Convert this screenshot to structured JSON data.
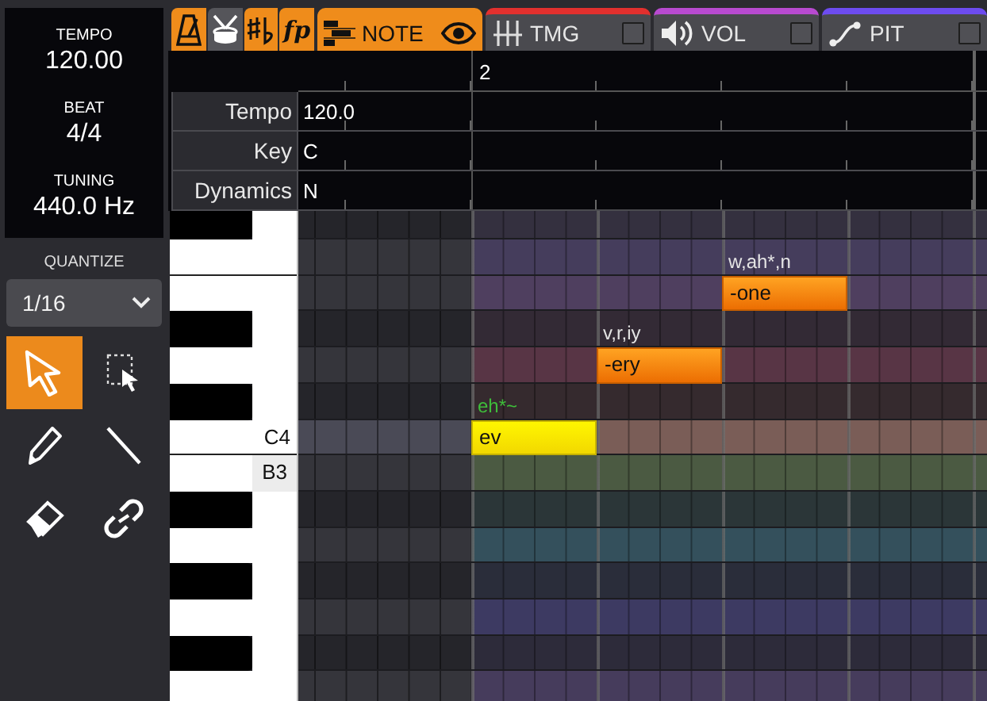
{
  "info": [
    {
      "label": "TEMPO",
      "value": "120.00"
    },
    {
      "label": "BEAT",
      "value": "4/4"
    },
    {
      "label": "TUNING",
      "value": "440.0 Hz"
    }
  ],
  "quantize": {
    "label": "QUANTIZE",
    "value": "1/16"
  },
  "tools": [
    {
      "kind": "select",
      "selected": true
    },
    {
      "kind": "marquee",
      "selected": false
    },
    {
      "kind": "pencil",
      "selected": false
    },
    {
      "kind": "line",
      "selected": false
    },
    {
      "kind": "eraser",
      "selected": false
    },
    {
      "kind": "link",
      "selected": false
    }
  ],
  "toggles": [
    {
      "kind": "metronome",
      "on": true
    },
    {
      "kind": "drum",
      "on": false
    },
    {
      "kind": "accidental",
      "on": true
    },
    {
      "kind": "dynamics",
      "label": "fp",
      "on": true
    }
  ],
  "tabs": [
    {
      "kind": "note",
      "label": "NOTE",
      "selected": true
    },
    {
      "kind": "timing",
      "label": "TMG",
      "color": "#e2302e",
      "selected": false,
      "checked": false
    },
    {
      "kind": "volume",
      "label": "VOL",
      "color": "#b84ad0",
      "selected": false,
      "checked": false
    },
    {
      "kind": "pitch",
      "label": "PIT",
      "color": "#6d4cf0",
      "selected": false,
      "checked": false
    }
  ],
  "ruler": {
    "bar": "2"
  },
  "expressions": [
    {
      "name": "Tempo",
      "value": "120.0"
    },
    {
      "name": "Key",
      "value": "C"
    },
    {
      "name": "Dynamics",
      "value": "N"
    }
  ],
  "rows": [
    {
      "kind": "black",
      "color": "#34303f"
    },
    {
      "kind": "white",
      "color": "#453d5c"
    },
    {
      "kind": "white",
      "color": "#4f3f5f",
      "notes": [
        {
          "lyric": "-one",
          "phonemes": "w,ah*,n",
          "selected": false,
          "edited": false
        }
      ]
    },
    {
      "kind": "black",
      "color": "#332a35"
    },
    {
      "kind": "white",
      "color": "#583545",
      "notes": [
        {
          "lyric": "-ery",
          "phonemes": "v,r,iy",
          "selected": false,
          "edited": false
        }
      ]
    },
    {
      "kind": "black",
      "color": "#352a2e"
    },
    {
      "kind": "white",
      "color": "#7a5d57",
      "label": "C4",
      "highlighted": true,
      "notes": [
        {
          "lyric": "ev",
          "phonemes": "eh*~",
          "selected": true,
          "edited": true
        }
      ]
    },
    {
      "kind": "white",
      "color": "#4b5a42",
      "label": "B3",
      "hovered": true
    },
    {
      "kind": "black",
      "color": "#2b3638"
    },
    {
      "kind": "white",
      "color": "#34505c"
    },
    {
      "kind": "black",
      "color": "#2a2d3a"
    },
    {
      "kind": "white",
      "color": "#3d3a62"
    },
    {
      "kind": "black",
      "color": "#2d2b3a"
    },
    {
      "kind": "white",
      "color": "#463c5c"
    }
  ]
}
